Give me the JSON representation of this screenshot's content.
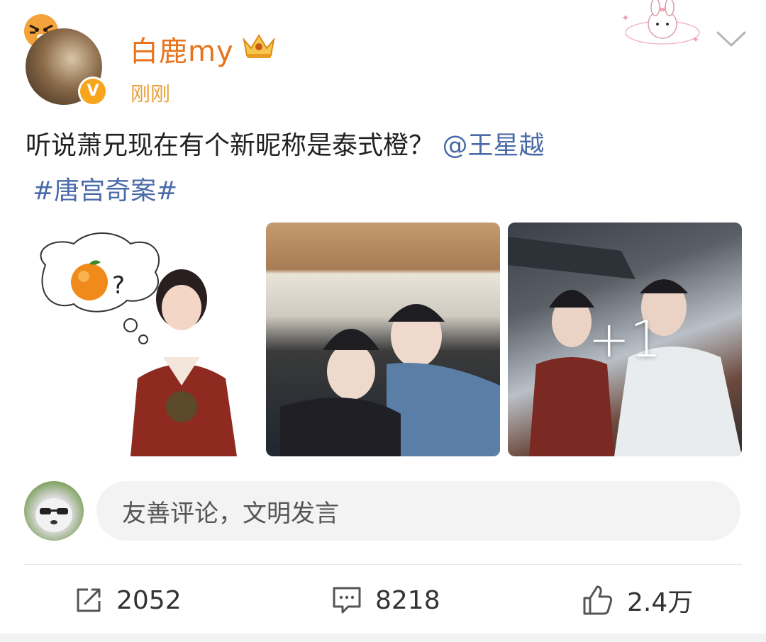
{
  "post": {
    "author": {
      "name": "白鹿my",
      "verified_badge": "V",
      "avatar_icon": "tiger-sticker-avatar",
      "crown_icon": "crown-badge-icon"
    },
    "timestamp": "刚刚",
    "text_main": "听说萧兄现在有个新昵称是泰式橙？",
    "mention": "@王星越",
    "topic": "#唐宫奇案#",
    "images": {
      "more_count_label": "+1"
    }
  },
  "comment_box": {
    "placeholder": "友善评论，文明发言"
  },
  "actions": {
    "repost_count": "2052",
    "comment_count": "8218",
    "like_count": "2.4万"
  },
  "colors": {
    "username": "#e8731a",
    "timestamp": "#e8a13c",
    "link": "#4a6aa8"
  }
}
